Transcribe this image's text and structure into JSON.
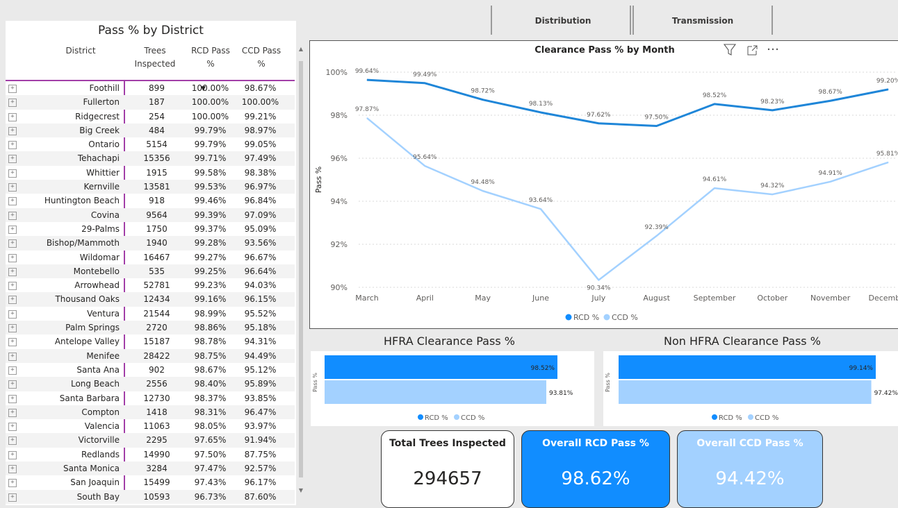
{
  "tabs": [
    "Distribution",
    "Transmission"
  ],
  "table": {
    "title": "Pass % by District",
    "headers": {
      "district": "District",
      "trees": "Trees Inspected",
      "rcd": "RCD Pass %",
      "ccd": "CCD Pass %"
    },
    "sort_indicator": "▼",
    "rows": [
      {
        "district": "Foothill",
        "trees": "899",
        "rcd": "100.00%",
        "ccd": "98.67%"
      },
      {
        "district": "Fullerton",
        "trees": "187",
        "rcd": "100.00%",
        "ccd": "100.00%"
      },
      {
        "district": "Ridgecrest",
        "trees": "254",
        "rcd": "100.00%",
        "ccd": "99.21%"
      },
      {
        "district": "Big Creek",
        "trees": "484",
        "rcd": "99.79%",
        "ccd": "98.97%"
      },
      {
        "district": "Ontario",
        "trees": "5154",
        "rcd": "99.79%",
        "ccd": "99.05%"
      },
      {
        "district": "Tehachapi",
        "trees": "15356",
        "rcd": "99.71%",
        "ccd": "97.49%"
      },
      {
        "district": "Whittier",
        "trees": "1915",
        "rcd": "99.58%",
        "ccd": "98.38%"
      },
      {
        "district": "Kernville",
        "trees": "13581",
        "rcd": "99.53%",
        "ccd": "96.97%"
      },
      {
        "district": "Huntington Beach",
        "trees": "918",
        "rcd": "99.46%",
        "ccd": "96.84%"
      },
      {
        "district": "Covina",
        "trees": "9564",
        "rcd": "99.39%",
        "ccd": "97.09%"
      },
      {
        "district": "29-Palms",
        "trees": "1750",
        "rcd": "99.37%",
        "ccd": "95.09%"
      },
      {
        "district": "Bishop/Mammoth",
        "trees": "1940",
        "rcd": "99.28%",
        "ccd": "93.56%"
      },
      {
        "district": "Wildomar",
        "trees": "16467",
        "rcd": "99.27%",
        "ccd": "96.67%"
      },
      {
        "district": "Montebello",
        "trees": "535",
        "rcd": "99.25%",
        "ccd": "96.64%"
      },
      {
        "district": "Arrowhead",
        "trees": "52781",
        "rcd": "99.23%",
        "ccd": "94.03%"
      },
      {
        "district": "Thousand Oaks",
        "trees": "12434",
        "rcd": "99.16%",
        "ccd": "96.15%"
      },
      {
        "district": "Ventura",
        "trees": "21544",
        "rcd": "98.99%",
        "ccd": "95.52%"
      },
      {
        "district": "Palm Springs",
        "trees": "2720",
        "rcd": "98.86%",
        "ccd": "95.18%"
      },
      {
        "district": "Antelope Valley",
        "trees": "15187",
        "rcd": "98.78%",
        "ccd": "94.31%"
      },
      {
        "district": "Menifee",
        "trees": "28422",
        "rcd": "98.75%",
        "ccd": "94.49%"
      },
      {
        "district": "Santa Ana",
        "trees": "902",
        "rcd": "98.67%",
        "ccd": "95.12%"
      },
      {
        "district": "Long Beach",
        "trees": "2556",
        "rcd": "98.40%",
        "ccd": "95.89%"
      },
      {
        "district": "Santa Barbara",
        "trees": "12730",
        "rcd": "98.37%",
        "ccd": "93.85%"
      },
      {
        "district": "Compton",
        "trees": "1418",
        "rcd": "98.31%",
        "ccd": "96.47%"
      },
      {
        "district": "Valencia",
        "trees": "11063",
        "rcd": "98.05%",
        "ccd": "93.97%"
      },
      {
        "district": "Victorville",
        "trees": "2295",
        "rcd": "97.65%",
        "ccd": "91.94%"
      },
      {
        "district": "Redlands",
        "trees": "14990",
        "rcd": "97.50%",
        "ccd": "87.75%"
      },
      {
        "district": "Santa Monica",
        "trees": "3284",
        "rcd": "97.47%",
        "ccd": "92.57%"
      },
      {
        "district": "San Joaquin",
        "trees": "15499",
        "rcd": "97.43%",
        "ccd": "96.17%"
      },
      {
        "district": "South Bay",
        "trees": "10593",
        "rcd": "96.73%",
        "ccd": "87.60%"
      }
    ]
  },
  "kpis": {
    "total_label": "Total Trees Inspected",
    "total_value": "294657",
    "rcd_label": "Overall RCD Pass %",
    "rcd_value": "98.62%",
    "ccd_label": "Overall CCD Pass %",
    "ccd_value": "94.42%"
  },
  "icons": {
    "filter": "filter-icon",
    "focus": "focus-mode-icon",
    "more": "more-options-icon",
    "expand": "expand-row-icon"
  },
  "colors": {
    "rcd": "#118dff",
    "ccd": "#a3d1ff",
    "rcd_line": "#1f86d8"
  },
  "chart_data": [
    {
      "type": "line",
      "title": "Clearance Pass % by Month",
      "ylabel": "Pass %",
      "ylim": [
        90,
        100
      ],
      "yticks": [
        "90%",
        "92%",
        "94%",
        "96%",
        "98%",
        "100%"
      ],
      "categories": [
        "March",
        "April",
        "May",
        "June",
        "July",
        "August",
        "September",
        "October",
        "November",
        "December"
      ],
      "series": [
        {
          "name": "RCD %",
          "values": [
            99.64,
            99.49,
            98.72,
            98.13,
            97.62,
            97.5,
            98.52,
            98.23,
            98.67,
            99.2
          ],
          "labels": [
            "99.64%",
            "99.49%",
            "98.72%",
            "98.13%",
            "97.62%",
            "97.50%",
            "98.52%",
            "98.23%",
            "98.67%",
            "99.20%"
          ]
        },
        {
          "name": "CCD %",
          "values": [
            97.87,
            95.64,
            94.48,
            93.64,
            90.34,
            92.39,
            94.61,
            94.32,
            94.91,
            95.81
          ],
          "labels": [
            "97.87%",
            "95.64%",
            "94.48%",
            "93.64%",
            "90.34%",
            "92.39%",
            "94.61%",
            "94.32%",
            "94.91%",
            "95.81%"
          ]
        }
      ],
      "legend": [
        "RCD %",
        "CCD %"
      ],
      "grid": true,
      "legend_position": "bottom"
    },
    {
      "type": "bar",
      "title": "HFRA Clearance Pass %",
      "ylabel": "Pass %",
      "series": [
        {
          "name": "RCD %",
          "values": [
            98.52
          ],
          "labels": [
            "98.52%"
          ]
        },
        {
          "name": "CCD %",
          "values": [
            93.81
          ],
          "labels": [
            "93.81%"
          ]
        }
      ],
      "legend": [
        "RCD %",
        "CCD %"
      ],
      "legend_position": "bottom"
    },
    {
      "type": "bar",
      "title": "Non HFRA Clearance Pass %",
      "ylabel": "Pass %",
      "series": [
        {
          "name": "RCD %",
          "values": [
            99.14
          ],
          "labels": [
            "99.14%"
          ]
        },
        {
          "name": "CCD %",
          "values": [
            97.42
          ],
          "labels": [
            "97.42%"
          ]
        }
      ],
      "legend": [
        "RCD %",
        "CCD %"
      ],
      "legend_position": "bottom"
    }
  ]
}
